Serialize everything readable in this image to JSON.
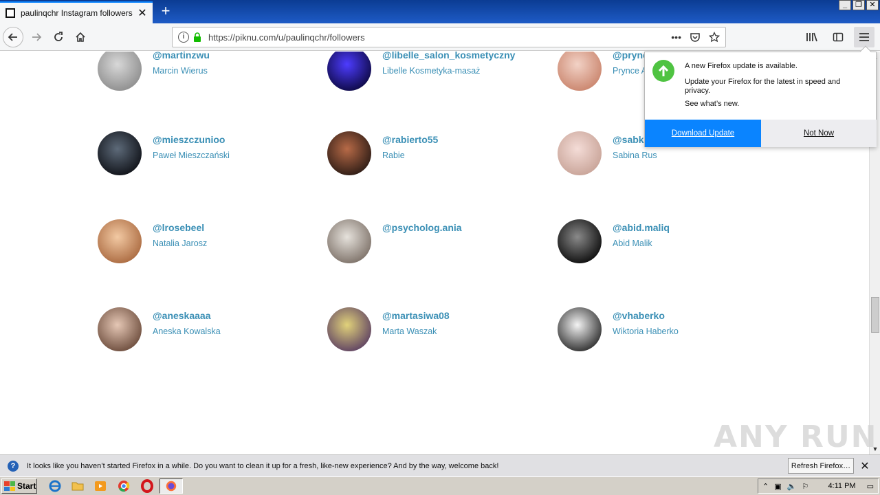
{
  "browser": {
    "tab_title": "paulinqchr Instagram followers - Pi",
    "url": "https://piknu.com/u/paulinqchr/followers",
    "new_tab_symbol": "+",
    "tab_close_symbol": "✕",
    "more_symbol": "•••",
    "window_buttons": [
      "_",
      "❐",
      "✕"
    ]
  },
  "followers": [
    {
      "handle": "@martinzwu",
      "name": "Marcin Wierus",
      "avatar_colors": [
        "#d8d8d8",
        "#8c8c8c"
      ]
    },
    {
      "handle": "@libelle_salon_kosmetyczny",
      "name": "Libelle Kosmetyka-masaż",
      "avatar_colors": [
        "#4d3cff",
        "#0c0840"
      ]
    },
    {
      "handle": "@prynce_burnaaa",
      "name": "Prynce A",
      "avatar_colors": [
        "#f2d2c6",
        "#c9836b"
      ]
    },
    {
      "handle": "@mieszczunioo",
      "name": "Paweł Mieszczański",
      "avatar_colors": [
        "#5d6a79",
        "#0e1016"
      ]
    },
    {
      "handle": "@rabierto55",
      "name": "Rabie",
      "avatar_colors": [
        "#b76a47",
        "#2a1a14"
      ]
    },
    {
      "handle": "@sabka",
      "name": "Sabina Rus",
      "avatar_colors": [
        "#f4dcd7",
        "#c7a296"
      ]
    },
    {
      "handle": "@lrosebeel",
      "name": "Natalia Jarosz",
      "avatar_colors": [
        "#f2c9a3",
        "#a9683e"
      ]
    },
    {
      "handle": "@psycholog.ania",
      "name": "",
      "avatar_colors": [
        "#e6e2dc",
        "#7b6f66"
      ]
    },
    {
      "handle": "@abid.maliq",
      "name": "Abid Malik",
      "avatar_colors": [
        "#8a8a8a",
        "#0a0a0a"
      ]
    },
    {
      "handle": "@aneskaaaa",
      "name": "Aneska Kowalska",
      "avatar_colors": [
        "#e5c7b5",
        "#6a4a3a"
      ]
    },
    {
      "handle": "@martasiwa08",
      "name": "Marta Waszak",
      "avatar_colors": [
        "#e1d27a",
        "#5b3e62"
      ]
    },
    {
      "handle": "@vhaberko",
      "name": "Wiktoria Haberko",
      "avatar_colors": [
        "#f4f4f4",
        "#2a2a2a"
      ]
    }
  ],
  "update_popup": {
    "title": "A new Firefox update is available.",
    "body": "Update your Firefox for the latest in speed and privacy.",
    "link": "See what’s new.",
    "download_label": "Download Update",
    "notnow_label": "Not Now"
  },
  "notification": {
    "text": "It looks like you haven’t started Firefox in a while. Do you want to clean it up for a fresh, like-new experience? And by the way, welcome back!",
    "button_label": "Refresh Firefox…",
    "close_symbol": "✕"
  },
  "watermark": "ANY RUN",
  "taskbar": {
    "start_label": "Start",
    "clock": "4:11 PM"
  },
  "colors": {
    "link": "#3a8fb5",
    "accent": "#0a84ff",
    "update_green": "#4fc342"
  }
}
